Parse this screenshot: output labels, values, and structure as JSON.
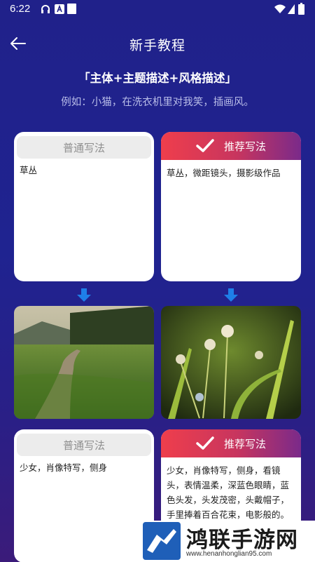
{
  "status": {
    "time": "6:22"
  },
  "header": {
    "title": "新手教程"
  },
  "intro": {
    "formula": "「主体+主题描述+风格描述」",
    "example": "例如：小猫，在洗衣机里对我笑，插画风。"
  },
  "examples": [
    {
      "normal": {
        "label": "普通写法",
        "text": "草丛"
      },
      "recommended": {
        "label": "推荐写法",
        "text": "草丛，微距镜头，摄影级作品"
      }
    },
    {
      "normal": {
        "label": "普通写法",
        "text": "少女，肖像特写，侧身"
      },
      "recommended": {
        "label": "推荐写法",
        "text": "少女，肖像特写，侧身，看镜头，表情温柔，深蓝色眼睛，蓝色头发，头发茂密，头戴帽子，手里捧着百合花束，电影般的。背景干净"
      }
    }
  ],
  "watermark": {
    "title": "鸿联手游网",
    "url": "www.henanhonglian95.com"
  },
  "colors": {
    "bg": "#20218a",
    "accent_start": "#ef3e4c",
    "accent_end": "#7a2a8a"
  }
}
